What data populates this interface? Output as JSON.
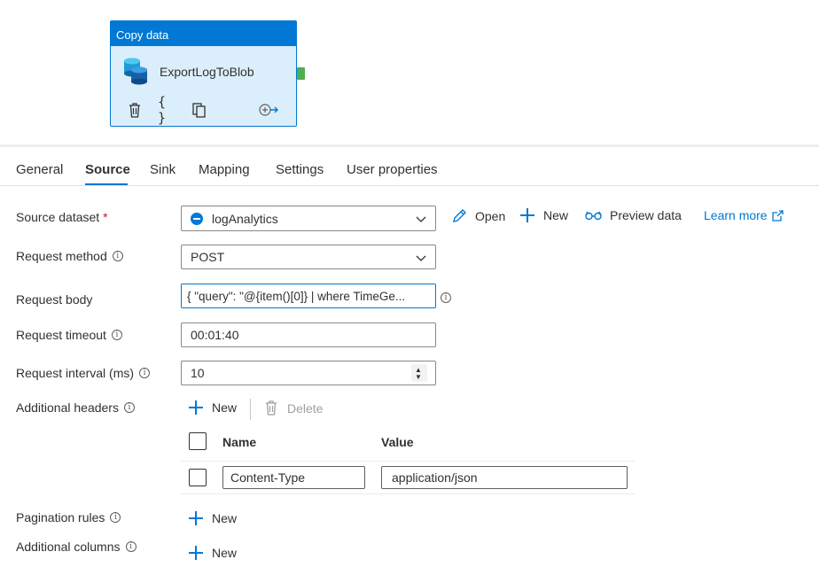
{
  "activity": {
    "type": "Copy data",
    "name": "ExportLogToBlob",
    "icons": [
      "database-icon",
      "delete-icon",
      "code-icon",
      "copy-icon",
      "output-arrow-icon"
    ]
  },
  "tabs": [
    {
      "label": "General"
    },
    {
      "label": "Source"
    },
    {
      "label": "Sink"
    },
    {
      "label": "Mapping"
    },
    {
      "label": "Settings"
    },
    {
      "label": "User properties"
    }
  ],
  "active_tab": "Source",
  "source_dataset": {
    "label": "Source dataset",
    "required_marker": "*",
    "value": "logAnalytics",
    "open_label": "Open",
    "new_label": "New",
    "preview_label": "Preview data",
    "learn_more_label": "Learn more"
  },
  "request_method": {
    "label": "Request method",
    "value": "POST"
  },
  "request_body": {
    "label": "Request body",
    "value": "{ \"query\": \"@{item()[0]} | where TimeGe..."
  },
  "request_timeout": {
    "label": "Request timeout",
    "value": "00:01:40"
  },
  "request_interval": {
    "label": "Request interval (ms)",
    "value": "10"
  },
  "additional_headers": {
    "label": "Additional headers",
    "new_label": "New",
    "delete_label": "Delete",
    "columns": [
      "Name",
      "Value"
    ],
    "rows": [
      {
        "name": "Content-Type",
        "value": "application/json"
      }
    ]
  },
  "pagination_rules": {
    "label": "Pagination rules",
    "new_label": "New"
  },
  "additional_columns": {
    "label": "Additional columns",
    "new_label": "New"
  },
  "colors": {
    "accent": "#0078d4",
    "activity_bg": "#dbeefb",
    "port": "#4caf50",
    "required": "#a4262c"
  }
}
